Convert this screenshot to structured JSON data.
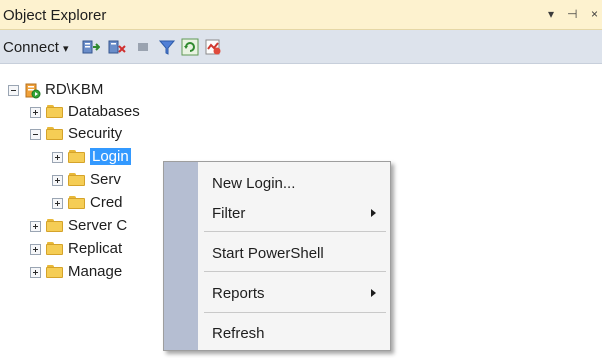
{
  "window": {
    "title": "Object Explorer",
    "pin_glyph": "▾ ꟼ ×"
  },
  "toolbar": {
    "connect_label": "Connect",
    "connect_arrow": "▾",
    "icons": [
      "connect-object-explorer-icon",
      "disconnect-icon",
      "stop-icon",
      "filter-icon",
      "refresh-icon",
      "activity-monitor-icon"
    ]
  },
  "tree": {
    "server": "RD\\KBM",
    "databases": "Databases",
    "security": "Security",
    "logins": "Login",
    "server_roles": "Serv",
    "credentials": "Cred",
    "server_objects": "Server C",
    "replication": "Replicat",
    "management": "Manage"
  },
  "context_menu": {
    "new_login": "New Login...",
    "filter": "Filter",
    "start_powershell": "Start PowerShell",
    "reports": "Reports",
    "refresh": "Refresh"
  },
  "colors": {
    "accent": "#3399ff",
    "folder": "#f5cd55",
    "menu_gutter": "#b5bed2"
  }
}
